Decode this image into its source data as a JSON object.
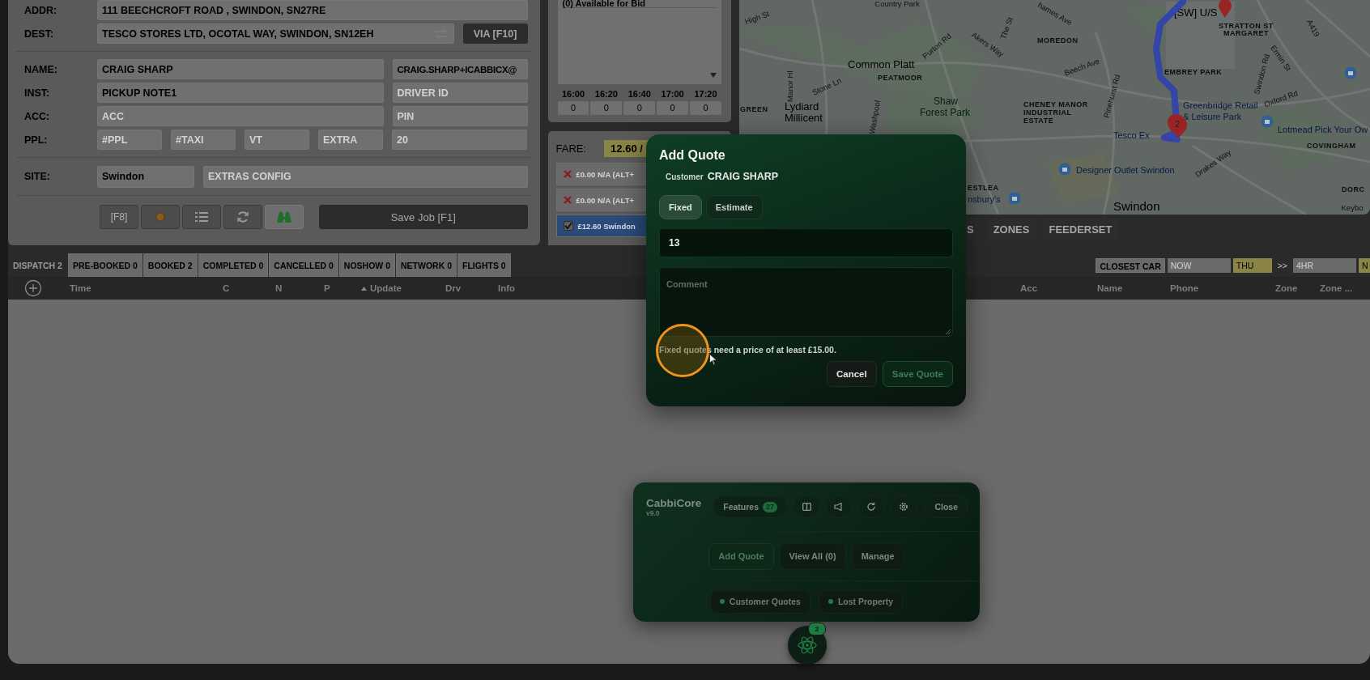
{
  "job_form": {
    "addr": {
      "label": "ADDR:",
      "value": "111 BEECHCROFT ROAD , SWINDON, SN27RE"
    },
    "dest": {
      "label": "DEST:",
      "value": "TESCO STORES LTD, OCOTAL WAY, SWINDON, SN12EH"
    },
    "via_button": "VIA [F10]",
    "name": {
      "label": "NAME:",
      "value": "CRAIG SHARP"
    },
    "email": {
      "value": "CRAIG.SHARP+ICABBICX@"
    },
    "inst": {
      "label": "INST:",
      "value": "PICKUP NOTE1"
    },
    "driver_id": {
      "placeholder": "DRIVER ID"
    },
    "acc": {
      "label": "ACC:",
      "placeholder": "ACC"
    },
    "pin": {
      "placeholder": "PIN"
    },
    "ppl": {
      "label": "PPL:",
      "fields": [
        {
          "placeholder": "#PPL"
        },
        {
          "placeholder": "#TAXI"
        },
        {
          "placeholder": "VT"
        },
        {
          "placeholder": "EXTRA"
        }
      ]
    },
    "ppl_extra": {
      "placeholder": "20"
    },
    "site": {
      "label": "SITE:",
      "value": "Swindon"
    },
    "extras": {
      "placeholder": "EXTRAS CONFIG"
    },
    "toolbar": [
      {
        "kind": "text",
        "label": "[F8]"
      },
      {
        "kind": "dot"
      },
      {
        "kind": "list"
      },
      {
        "kind": "refresh"
      },
      {
        "kind": "map"
      }
    ],
    "save_button": "Save Job [F1]"
  },
  "bid_panel": {
    "header": "(0) Available for Bid",
    "slots": [
      {
        "time": "16:00",
        "count": "0"
      },
      {
        "time": "16:20",
        "count": "0"
      },
      {
        "time": "16:40",
        "count": "0"
      },
      {
        "time": "17:00",
        "count": "0"
      },
      {
        "time": "17:20",
        "count": "0"
      }
    ]
  },
  "fare_panel": {
    "label": "FARE:",
    "value": "12.60 /",
    "options": [
      {
        "text": "£0.00 N/A (ALT+",
        "selected": false
      },
      {
        "text": "£0.00 N/A (ALT+",
        "selected": false
      },
      {
        "text": "£12.60 Swindon",
        "selected": true
      }
    ]
  },
  "map": {
    "labels": [
      "High St",
      "Country Park",
      "Manor Hl",
      "Common Platt",
      "Stone Ln",
      "PEATMOOR",
      "Purton Rd",
      "The St",
      "hames Ave",
      "Akers Way",
      "MOREDON",
      "Beech Ave",
      "Pinehurst Rd",
      "Washpool",
      "Shaw",
      "Forest Park",
      "CHENEY MANOR",
      "INDUSTRIAL",
      "ESTATE",
      "GREEN",
      "Lydiard",
      "Millicent",
      "[SW] U/S",
      "STRATTON ST",
      "MARGARET",
      "Swindon Rd",
      "Ermin St",
      "A419",
      "EMBREY PARK",
      "Greenbridge Retail",
      "& Leisure Park",
      "Oxford Rd",
      "Lotmead Pick Your Ow",
      "COVINGHAM",
      "Tesco Ex",
      "Drakes Way",
      "Designer Outlet Swindon",
      "ESTLEA",
      "nsbury's",
      "Swindon",
      "DORC",
      "Keybo"
    ],
    "pin_label": "2",
    "buttons": [
      "S",
      "ZONES",
      "FEEDERSET"
    ]
  },
  "tabs": [
    {
      "label": "DISPATCH 2",
      "selected": true
    },
    {
      "label": "PRE-BOOKED 0",
      "selected": false
    },
    {
      "label": "BOOKED 2",
      "selected": false
    },
    {
      "label": "COMPLETED 0",
      "selected": false
    },
    {
      "label": "CANCELLED 0",
      "selected": false
    },
    {
      "label": "NOSHOW 0",
      "selected": false
    },
    {
      "label": "NETWORK 0",
      "selected": false
    },
    {
      "label": "FLIGHTS 0",
      "selected": false
    }
  ],
  "filters": [
    {
      "label": "CLOSEST CAR",
      "kind": "button"
    },
    {
      "label": "NOW",
      "kind": "field"
    },
    {
      "label": "THU",
      "kind": "highlight"
    },
    {
      "label": ">>",
      "kind": "text"
    },
    {
      "label": "4HR",
      "kind": "field"
    },
    {
      "label": "N",
      "kind": "highlight"
    }
  ],
  "columns": [
    {
      "label": "Time",
      "sorted": false
    },
    {
      "label": "C",
      "sorted": false
    },
    {
      "label": "N",
      "sorted": false
    },
    {
      "label": "P",
      "sorted": false
    },
    {
      "label": "Update",
      "sorted": true
    },
    {
      "label": "Drv",
      "sorted": false
    },
    {
      "label": "Info",
      "sorted": false
    },
    {
      "label": "Acc",
      "sorted": false
    },
    {
      "label": "Name",
      "sorted": false
    },
    {
      "label": "Phone",
      "sorted": false
    },
    {
      "label": "Zone",
      "sorted": false
    },
    {
      "label": "Zone ...",
      "sorted": false
    }
  ],
  "dialog": {
    "title": "Add Quote",
    "customer_label": "Customer",
    "customer_name": "CRAIG SHARP",
    "modes": [
      {
        "label": "Fixed",
        "selected": true
      },
      {
        "label": "Estimate",
        "selected": false
      }
    ],
    "price": {
      "value": "13"
    },
    "comment": {
      "placeholder": "Comment"
    },
    "message": "Fixed quotes need a price of at least £15.00.",
    "buttons": [
      {
        "label": "Cancel",
        "kind": "cancel"
      },
      {
        "label": "Save Quote",
        "kind": "save",
        "disabled": true
      }
    ]
  },
  "cabbicore": {
    "title": "CabbiCore",
    "version": "v9.0",
    "features": {
      "label": "Features",
      "count": "27"
    },
    "icon_buttons": [
      {
        "kind": "panel"
      },
      {
        "kind": "megaphone"
      },
      {
        "kind": "refresh"
      },
      {
        "kind": "settings"
      }
    ],
    "close": "Close",
    "actions": [
      {
        "label": "Add Quote",
        "selected": true
      },
      {
        "label": "View All (0)",
        "selected": false
      },
      {
        "label": "Manage",
        "selected": false
      }
    ],
    "modules": [
      {
        "label": "Customer Quotes",
        "enabled": true
      },
      {
        "label": "Lost Property",
        "enabled": true
      }
    ],
    "fab_badge": "2"
  }
}
